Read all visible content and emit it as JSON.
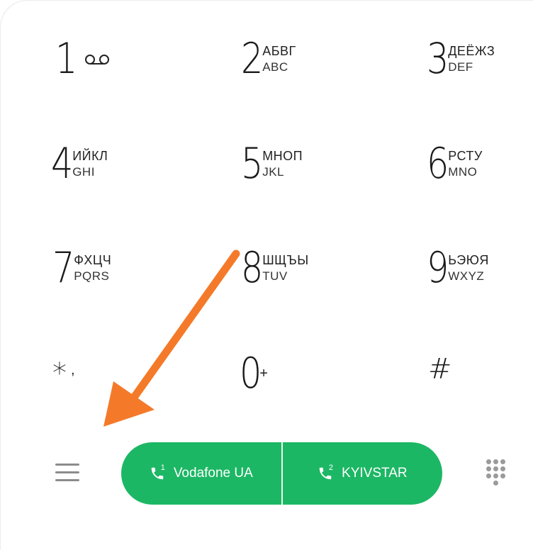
{
  "keys": [
    {
      "digit": "1",
      "letters_ru": "",
      "letters_en": ""
    },
    {
      "digit": "2",
      "letters_ru": "АБВГ",
      "letters_en": "ABC"
    },
    {
      "digit": "3",
      "letters_ru": "ДЕЁЖЗ",
      "letters_en": "DEF"
    },
    {
      "digit": "4",
      "letters_ru": "ИЙКЛ",
      "letters_en": "GHI"
    },
    {
      "digit": "5",
      "letters_ru": "МНОП",
      "letters_en": "JKL"
    },
    {
      "digit": "6",
      "letters_ru": "РСТУ",
      "letters_en": "MNO"
    },
    {
      "digit": "7",
      "letters_ru": "ФХЦЧ",
      "letters_en": "PQRS"
    },
    {
      "digit": "8",
      "letters_ru": "ШЩЪЫ",
      "letters_en": "TUV"
    },
    {
      "digit": "9",
      "letters_ru": "ЬЭЮЯ",
      "letters_en": "WXYZ"
    },
    {
      "digit": "*",
      "sub": ","
    },
    {
      "digit": "0",
      "sub": "+"
    },
    {
      "digit": "#",
      "sub": ""
    }
  ],
  "call": {
    "sim1": {
      "number": "1",
      "label": "Vodafone UA"
    },
    "sim2": {
      "number": "2",
      "label": "KYIVSTAR"
    }
  },
  "icons": {
    "voicemail": "voicemail-icon",
    "menu": "menu-icon",
    "phone": "phone-icon",
    "keypad": "dialpad-icon"
  },
  "colors": {
    "call_green": "#1cb764",
    "arrow_orange": "#f47a2a"
  }
}
